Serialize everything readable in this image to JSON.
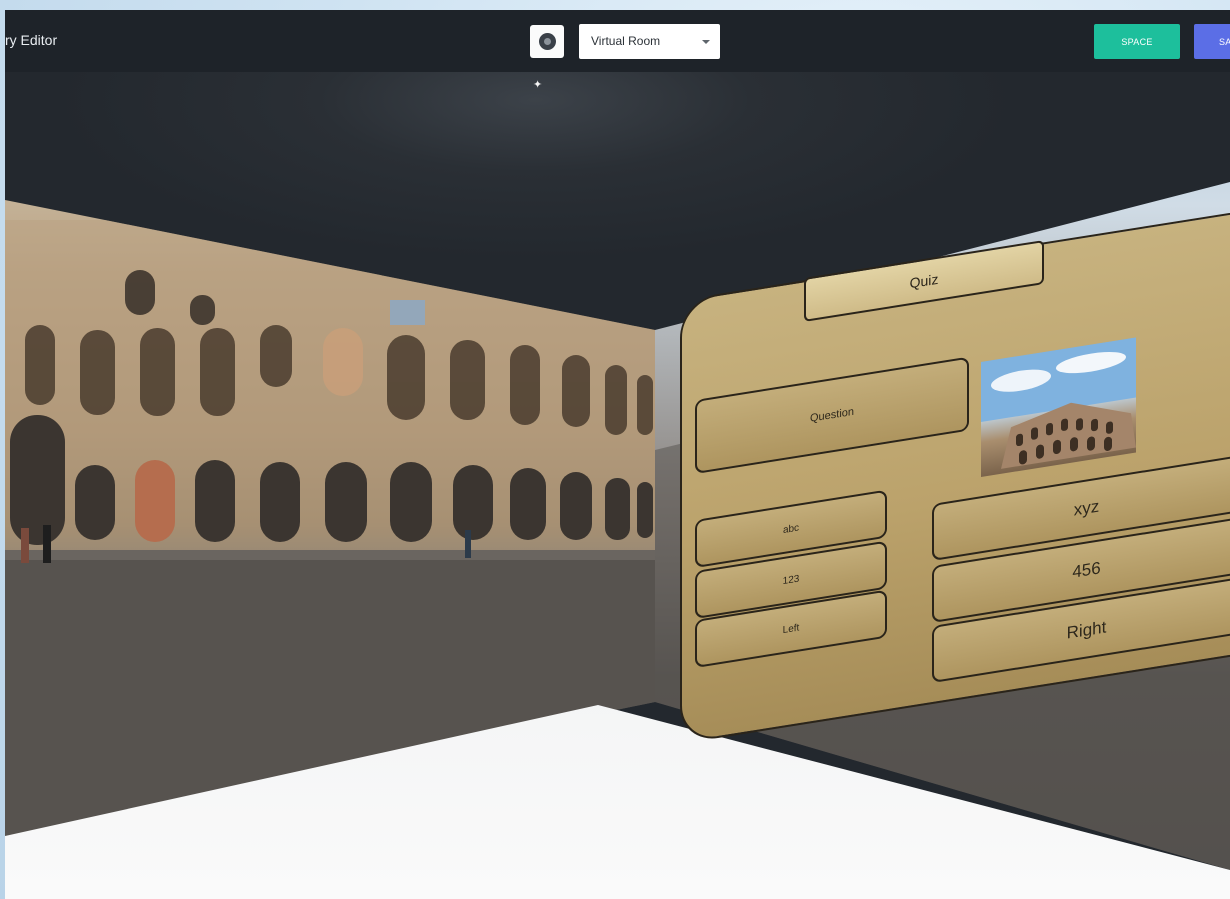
{
  "header": {
    "title": "ry Editor",
    "room_select": {
      "value": "Virtual Room"
    },
    "space_label": "SPACE",
    "save_label": "SA"
  },
  "quiz": {
    "title": "Quiz",
    "question_label": "Question",
    "answers_left": [
      "abc",
      "123",
      "Left"
    ],
    "answers_right": [
      "xyz",
      "456",
      "Right"
    ]
  },
  "icons": {
    "settings": "settings-disc-icon",
    "dropdown": "chevron-down-icon",
    "light": "sparkle-icon"
  },
  "colors": {
    "toolbar_bg": "#1e2329",
    "space_button": "#1dbf9c",
    "save_button": "#5b6ee6",
    "quiz_panel": "#bba26b"
  }
}
